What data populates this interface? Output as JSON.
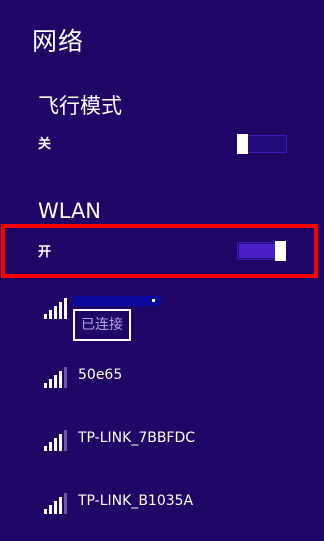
{
  "panel": {
    "title": "网络"
  },
  "airplane_mode": {
    "heading": "飞行模式",
    "state_label": "关",
    "is_on": false
  },
  "wlan": {
    "heading": "WLAN",
    "state_label": "开",
    "is_on": true
  },
  "networks": [
    {
      "name": "",
      "status": "已连接",
      "signal_bars": 5
    },
    {
      "name": "50e65",
      "signal_bars": 4
    },
    {
      "name": "TP-LINK_7BBFDC",
      "signal_bars": 4
    },
    {
      "name": "TP-LINK_B1035A",
      "signal_bars": 4
    }
  ],
  "colors": {
    "background": "#1e0566",
    "toggle_accent": "#4b1fc7",
    "highlight": "#ff0000"
  }
}
